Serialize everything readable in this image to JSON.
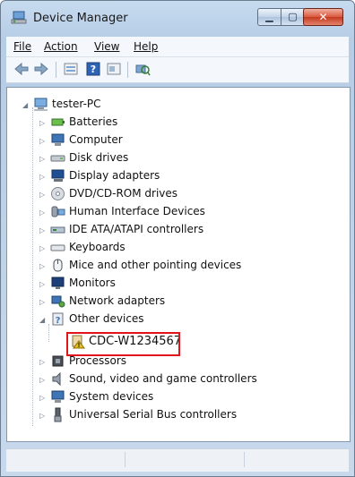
{
  "window": {
    "title": "Device Manager"
  },
  "menu": [
    {
      "label": "File"
    },
    {
      "label": "Action"
    },
    {
      "label": "View"
    },
    {
      "label": "Help"
    }
  ],
  "toolbar": [
    {
      "icon": "back-arrow-icon"
    },
    {
      "icon": "forward-arrow-icon"
    },
    {
      "icon": "properties-icon"
    },
    {
      "icon": "help-icon"
    },
    {
      "icon": "show-hidden-icon"
    },
    {
      "icon": "scan-hardware-icon"
    }
  ],
  "tree": {
    "root": "tester-PC",
    "items": [
      {
        "label": "Batteries"
      },
      {
        "label": "Computer"
      },
      {
        "label": "Disk drives"
      },
      {
        "label": "Display adapters"
      },
      {
        "label": "DVD/CD-ROM drives"
      },
      {
        "label": "Human Interface Devices"
      },
      {
        "label": "IDE ATA/ATAPI controllers"
      },
      {
        "label": "Keyboards"
      },
      {
        "label": "Mice and other pointing devices"
      },
      {
        "label": "Monitors"
      },
      {
        "label": "Network adapters"
      },
      {
        "label": "Other devices"
      },
      {
        "label": "CDC-W1234567"
      },
      {
        "label": "Processors"
      },
      {
        "label": "Sound, video and game controllers"
      },
      {
        "label": "System devices"
      },
      {
        "label": "Universal Serial Bus controllers"
      }
    ]
  },
  "colors": {
    "highlight_border": "#e1141b",
    "warning": "#e8c21a"
  }
}
